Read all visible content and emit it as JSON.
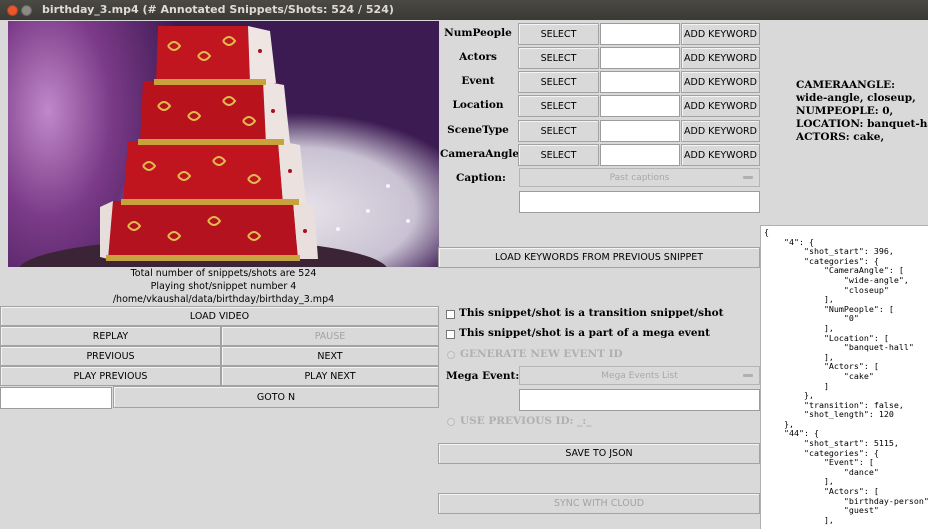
{
  "window": {
    "title": "birthday_3.mp4 (# Annotated Snippets/Shots: 524 / 524)"
  },
  "video_info": {
    "total": "Total number of snippets/shots are 524",
    "playing": "Playing shot/snippet number 4",
    "path": "/home/vkaushal/data/birthday/birthday_3.mp4"
  },
  "controls": {
    "load_video": "LOAD VIDEO",
    "replay": "REPLAY",
    "pause": "PAUSE",
    "previous": "PREVIOUS",
    "next": "NEXT",
    "play_previous": "PLAY PREVIOUS",
    "play_next": "PLAY NEXT",
    "goto_n": "GOTO N",
    "goto_value": ""
  },
  "categories": [
    {
      "label": "NumPeople",
      "select": "SELECT",
      "add": "ADD KEYWORD",
      "value": ""
    },
    {
      "label": "Actors",
      "select": "SELECT",
      "add": "ADD KEYWORD",
      "value": ""
    },
    {
      "label": "Event",
      "select": "SELECT",
      "add": "ADD KEYWORD",
      "value": ""
    },
    {
      "label": "Location",
      "select": "SELECT",
      "add": "ADD KEYWORD",
      "value": ""
    },
    {
      "label": "SceneType",
      "select": "SELECT",
      "add": "ADD KEYWORD",
      "value": ""
    },
    {
      "label": "CameraAngle",
      "select": "SELECT",
      "add": "ADD KEYWORD",
      "value": ""
    }
  ],
  "caption": {
    "label": "Caption:",
    "combo": "Past captions",
    "value": ""
  },
  "load_keywords": "LOAD KEYWORDS FROM PREVIOUS SNIPPET",
  "checks": {
    "transition": "This snippet/shot is a transition snippet/shot",
    "mega": "This snippet/shot is a part of a mega event"
  },
  "generate_id": "GENERATE NEW EVENT ID",
  "mega_event": {
    "label": "Mega Event:",
    "combo": "Mega Events List",
    "value": ""
  },
  "use_prev_id": "USE PREVIOUS ID: _:_",
  "save_json": "SAVE TO JSON",
  "sync_cloud": "SYNC WITH CLOUD",
  "summary": [
    "CAMERAANGLE:",
    "wide-angle, closeup,",
    "NUMPEOPLE: 0,",
    "LOCATION: banquet-hall,",
    "ACTORS: cake,"
  ],
  "json_text": "{\n    \"4\": {\n        \"shot_start\": 396,\n        \"categories\": {\n            \"CameraAngle\": [\n                \"wide-angle\",\n                \"closeup\"\n            ],\n            \"NumPeople\": [\n                \"0\"\n            ],\n            \"Location\": [\n                \"banquet-hall\"\n            ],\n            \"Actors\": [\n                \"cake\"\n            ]\n        },\n        \"transition\": false,\n        \"shot_length\": 120\n    },\n    \"44\": {\n        \"shot_start\": 5115,\n        \"categories\": {\n            \"Event\": [\n                \"dance\"\n            ],\n            \"Actors\": [\n                \"birthday-person\",\n                \"guest\"\n            ],"
}
